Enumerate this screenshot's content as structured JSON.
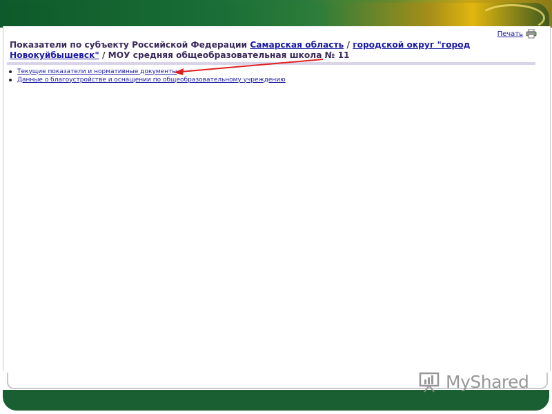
{
  "print": {
    "label": "Печать",
    "icon": "printer-icon"
  },
  "title": {
    "prefix": "Показатели по субъекту Российской Федерации",
    "region_link": "Самарская область",
    "separator_1": "/",
    "district_link": "городской округ \"город Новокуйбышевск\"",
    "separator_2": "/",
    "school": "МОУ средняя общеобразовательная школа № 11"
  },
  "links": [
    {
      "label": "Текущие показатели и нормативные документы"
    },
    {
      "label": "Данные о благоустройстве и оснащении по общеобразовательному учреждению"
    }
  ],
  "annotation": {
    "arrow_color": "#e02020"
  },
  "watermark": {
    "text": "MyShared",
    "icon": "presentation-chart-icon"
  },
  "colors": {
    "frame_green": "#1a5f31",
    "link_blue": "#1a1aa6",
    "title_text": "#3a2a5a"
  }
}
